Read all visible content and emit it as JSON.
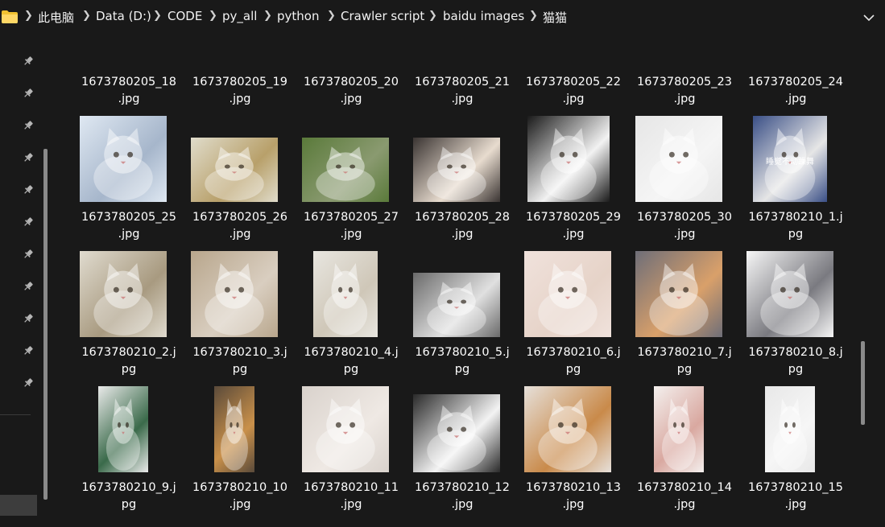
{
  "address_bar": {
    "crumbs": [
      "此电脑",
      "Data (D:)",
      "CODE",
      "py_all",
      "python",
      "Crawler script",
      "baidu images",
      "猫猫"
    ]
  },
  "colors": {
    "background": "#191919",
    "folder_icon": "#f1c232",
    "text": "#ffffff"
  },
  "files": [
    {
      "line1": "1673780205_18",
      "line2": ".jpg"
    },
    {
      "line1": "1673780205_19",
      "line2": ".jpg"
    },
    {
      "line1": "1673780205_20",
      "line2": ".jpg"
    },
    {
      "line1": "1673780205_21",
      "line2": ".jpg"
    },
    {
      "line1": "1673780205_22",
      "line2": ".jpg"
    },
    {
      "line1": "1673780205_23",
      "line2": ".jpg"
    },
    {
      "line1": "1673780205_24",
      "line2": ".jpg"
    },
    {
      "line1": "1673780205_25",
      "line2": ".jpg"
    },
    {
      "line1": "1673780205_26",
      "line2": ".jpg"
    },
    {
      "line1": "1673780205_27",
      "line2": ".jpg"
    },
    {
      "line1": "1673780205_28",
      "line2": ".jpg"
    },
    {
      "line1": "1673780205_29",
      "line2": ".jpg"
    },
    {
      "line1": "1673780205_30",
      "line2": ".jpg"
    },
    {
      "line1": "1673780210_1.j",
      "line2": "pg",
      "overlay_text": "睡觉不动躁舞"
    },
    {
      "line1": "1673780210_2.j",
      "line2": "pg"
    },
    {
      "line1": "1673780210_3.j",
      "line2": "pg"
    },
    {
      "line1": "1673780210_4.j",
      "line2": "pg"
    },
    {
      "line1": "1673780210_5.j",
      "line2": "pg"
    },
    {
      "line1": "1673780210_6.j",
      "line2": "pg"
    },
    {
      "line1": "1673780210_7.j",
      "line2": "pg"
    },
    {
      "line1": "1673780210_8.j",
      "line2": "pg"
    },
    {
      "line1": "1673780210_9.j",
      "line2": "pg"
    },
    {
      "line1": "1673780210_10",
      "line2": ".jpg"
    },
    {
      "line1": "1673780210_11",
      "line2": ".jpg"
    },
    {
      "line1": "1673780210_12",
      "line2": ".jpg"
    },
    {
      "line1": "1673780210_13",
      "line2": ".jpg"
    },
    {
      "line1": "1673780210_14",
      "line2": ".jpg"
    },
    {
      "line1": "1673780210_15",
      "line2": ".jpg"
    }
  ]
}
